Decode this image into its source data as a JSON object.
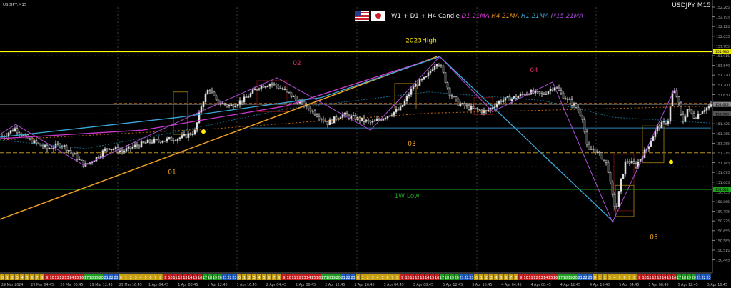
{
  "chart_data": {
    "type": "candlestick",
    "symbol_label": "USDJPY,M15",
    "corner_label": "USDJPY M15",
    "legend": {
      "prefix": "W1 + D1 + H4 Candle",
      "items": [
        {
          "label": "D1 21MA",
          "color": "#d13ad1"
        },
        {
          "label": "H4 21MA",
          "color": "#e8901c"
        },
        {
          "label": "H1 21MA",
          "color": "#3aa8d8"
        },
        {
          "label": "M15 21MA",
          "color": "#a64ad8"
        }
      ]
    },
    "price_ticks": [
      "152.265",
      "152.195",
      "152.125",
      "152.055",
      "151.985",
      "151.915",
      "151.840",
      "151.770",
      "151.700",
      "151.630",
      "151.560",
      "151.495",
      "151.425",
      "151.355",
      "151.285",
      "151.215",
      "151.145",
      "151.075",
      "151.005",
      "150.935",
      "150.865",
      "150.795",
      "150.725",
      "150.655",
      "150.585",
      "150.515",
      "150.445"
    ],
    "ylim": [
      150.42,
      152.3
    ],
    "price_tags": [
      {
        "value": "151.986",
        "price": 151.986,
        "color": "#e8e800"
      },
      {
        "value": "151.612",
        "price": 151.612,
        "color": "#888888"
      },
      {
        "value": "151.545",
        "price": 151.545,
        "color": "#555555"
      },
      {
        "value": "151.011",
        "price": 151.011,
        "color": "#1ea01e"
      }
    ],
    "levels": [
      {
        "name": "2023High",
        "price": 151.986,
        "color": "#ffff00",
        "width": 2
      },
      {
        "name": "1W Low",
        "price": 151.011,
        "color": "#1ea01e",
        "width": 1
      }
    ],
    "annotations": [
      {
        "text": "2023High",
        "color": "#f0e000",
        "x": 590,
        "price": 152.05
      },
      {
        "text": "02",
        "color": "#e0306a",
        "x": 416,
        "price": 151.89
      },
      {
        "text": "04",
        "color": "#e0306a",
        "x": 748,
        "price": 151.84
      },
      {
        "text": "03",
        "color": "#e8a020",
        "x": 577,
        "price": 151.32
      },
      {
        "text": "01",
        "color": "#e8a020",
        "x": 241,
        "price": 151.12
      },
      {
        "text": "05",
        "color": "#e8a020",
        "x": 916,
        "price": 150.66
      },
      {
        "text": "1W Low",
        "color": "#1ea01e",
        "x": 570,
        "price": 150.95
      }
    ],
    "time_labels": [
      "29 Mar 2024",
      "29 Mar 04:45",
      "29 Mar 08:45",
      "29 Mar 12:45",
      "29 Mar 16:45",
      "1 Apr 04:45",
      "1 Apr 08:45",
      "1 Apr 12:45",
      "1 Apr 16:45",
      "2 Apr 04:45",
      "2 Apr 08:45",
      "2 Apr 12:45",
      "2 Apr 16:45",
      "3 Apr 04:45",
      "3 Apr 08:45",
      "3 Apr 12:45",
      "3 Apr 16:45",
      "4 Apr 04:45",
      "4 Apr 08:45",
      "4 Apr 12:45",
      "4 Apr 16:45",
      "5 Apr 04:45",
      "5 Apr 08:45",
      "5 Apr 12:45",
      "5 Apr 16:45"
    ],
    "session_hours": [
      "0",
      "1",
      "2",
      "3",
      "4",
      "5",
      "6",
      "7",
      "8",
      "9",
      "10",
      "11",
      "12",
      "13",
      "14",
      "15",
      "16",
      "17",
      "18",
      "19",
      "20",
      "21",
      "22",
      "23"
    ],
    "candle_path": [
      [
        0,
        151.38
      ],
      [
        20,
        151.44
      ],
      [
        40,
        151.36
      ],
      [
        65,
        151.3
      ],
      [
        85,
        151.33
      ],
      [
        100,
        151.27
      ],
      [
        118,
        151.18
      ],
      [
        135,
        151.24
      ],
      [
        150,
        151.31
      ],
      [
        170,
        151.28
      ],
      [
        190,
        151.32
      ],
      [
        210,
        151.35
      ],
      [
        230,
        151.36
      ],
      [
        255,
        151.38
      ],
      [
        272,
        151.42
      ],
      [
        282,
        151.62
      ],
      [
        292,
        151.73
      ],
      [
        302,
        151.63
      ],
      [
        322,
        151.6
      ],
      [
        342,
        151.65
      ],
      [
        362,
        151.74
      ],
      [
        380,
        151.76
      ],
      [
        398,
        151.71
      ],
      [
        418,
        151.63
      ],
      [
        438,
        151.56
      ],
      [
        458,
        151.48
      ],
      [
        478,
        151.54
      ],
      [
        500,
        151.51
      ],
      [
        520,
        151.48
      ],
      [
        540,
        151.53
      ],
      [
        560,
        151.58
      ],
      [
        578,
        151.74
      ],
      [
        596,
        151.8
      ],
      [
        606,
        151.88
      ],
      [
        612,
        151.92
      ],
      [
        618,
        151.86
      ],
      [
        628,
        151.7
      ],
      [
        640,
        151.62
      ],
      [
        660,
        151.58
      ],
      [
        680,
        151.56
      ],
      [
        700,
        151.64
      ],
      [
        720,
        151.66
      ],
      [
        740,
        151.7
      ],
      [
        758,
        151.68
      ],
      [
        776,
        151.74
      ],
      [
        790,
        151.66
      ],
      [
        805,
        151.6
      ],
      [
        815,
        151.52
      ],
      [
        822,
        151.28
      ],
      [
        830,
        151.3
      ],
      [
        842,
        151.24
      ],
      [
        850,
        151.18
      ],
      [
        856,
        150.98
      ],
      [
        862,
        150.86
      ],
      [
        868,
        151.05
      ],
      [
        876,
        151.22
      ],
      [
        890,
        151.18
      ],
      [
        905,
        151.3
      ],
      [
        920,
        151.45
      ],
      [
        935,
        151.5
      ],
      [
        942,
        151.72
      ],
      [
        948,
        151.66
      ],
      [
        955,
        151.48
      ],
      [
        962,
        151.58
      ],
      [
        972,
        151.52
      ],
      [
        985,
        151.58
      ],
      [
        996,
        151.6
      ]
    ],
    "zigzag": [
      [
        0,
        151.4
      ],
      [
        22,
        151.47
      ],
      [
        118,
        151.18
      ],
      [
        276,
        151.55
      ],
      [
        388,
        151.8
      ],
      [
        519,
        151.43
      ],
      [
        616,
        151.95
      ],
      [
        690,
        151.56
      ],
      [
        774,
        151.77
      ],
      [
        858,
        150.78
      ],
      [
        945,
        151.72
      ]
    ],
    "d1_ma": [
      [
        0,
        151.37
      ],
      [
        200,
        151.43
      ],
      [
        400,
        151.6
      ],
      [
        616,
        151.95
      ]
    ],
    "h4_ma": [
      [
        0,
        150.8
      ],
      [
        200,
        151.06
      ],
      [
        400,
        151.44
      ],
      [
        616,
        151.95
      ]
    ],
    "h1_ma": [
      [
        0,
        151.38
      ],
      [
        250,
        151.52
      ],
      [
        450,
        151.66
      ],
      [
        616,
        151.95
      ],
      [
        860,
        150.78
      ]
    ],
    "m15_ma": [
      [
        0,
        151.36
      ],
      [
        120,
        151.3
      ],
      [
        250,
        151.42
      ],
      [
        400,
        151.58
      ],
      [
        600,
        151.7
      ],
      [
        760,
        151.64
      ],
      [
        860,
        151.52
      ],
      [
        996,
        151.48
      ]
    ],
    "orange_diagonal": [
      [
        0,
        150.8
      ],
      [
        612,
        151.95
      ]
    ],
    "orange_dotted": [
      [
        0,
        151.36
      ],
      [
        300,
        151.44
      ],
      [
        600,
        151.55
      ],
      [
        996,
        151.6
      ]
    ],
    "h_lines": [
      {
        "price": 151.612,
        "color": "#7a7a7a",
        "dash": ""
      },
      {
        "price": 151.545,
        "color": "#4a4a4a",
        "dash": "3,3"
      },
      {
        "price": 151.445,
        "color": "#2a82b8",
        "dash": "",
        "x1": 350,
        "x2": 996
      },
      {
        "price": 151.27,
        "color": "#b89020",
        "dash": "6,3"
      },
      {
        "price": 151.62,
        "color": "#8a5010",
        "dash": "4,3",
        "x1": 160,
        "x2": 996
      }
    ],
    "yellow_dots": [
      [
        285,
        151.42
      ],
      [
        940,
        151.205
      ]
    ]
  }
}
